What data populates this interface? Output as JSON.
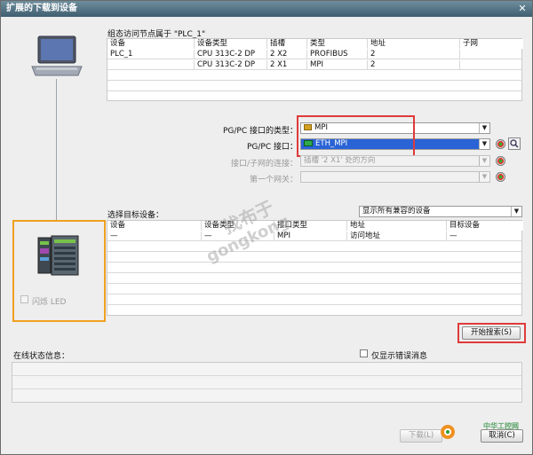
{
  "window": {
    "title": "扩展的下载到设备",
    "close_glyph": "✕"
  },
  "config_access": {
    "heading": "组态访问节点属于 \"PLC_1\"",
    "columns": [
      "设备",
      "设备类型",
      "插槽",
      "类型",
      "地址",
      "子网"
    ],
    "rows": [
      [
        "PLC_1",
        "CPU 313C-2 DP",
        "2 X2",
        "PROFIBUS",
        "2",
        ""
      ],
      [
        "",
        "CPU 313C-2 DP",
        "2 X1",
        "MPI",
        "2",
        ""
      ],
      [
        "",
        "",
        "",
        "",
        "",
        ""
      ],
      [
        "",
        "",
        "",
        "",
        "",
        ""
      ],
      [
        "",
        "",
        "",
        "",
        "",
        ""
      ]
    ]
  },
  "interface": {
    "type_label": "PG/PC 接口的类型：",
    "type_value": "MPI",
    "iface_label": "PG/PC 接口：",
    "iface_value": "ETH_MPI",
    "subnet_label": "接口/子网的连接：",
    "subnet_value": "插槽 '2 X1' 处的方向",
    "gateway_label": "第一个网关："
  },
  "target": {
    "heading": "选择目标设备：",
    "filter_value": "显示所有兼容的设备",
    "columns": [
      "设备",
      "设备类型",
      "接口类型",
      "地址",
      "目标设备"
    ],
    "rows": [
      [
        "—",
        "—",
        "MPI",
        "访问地址",
        "—"
      ],
      [
        "",
        "",
        "",
        "",
        ""
      ],
      [
        "",
        "",
        "",
        "",
        ""
      ],
      [
        "",
        "",
        "",
        "",
        ""
      ],
      [
        "",
        "",
        "",
        "",
        ""
      ],
      [
        "",
        "",
        "",
        "",
        ""
      ],
      [
        "",
        "",
        "",
        "",
        ""
      ],
      [
        "",
        "",
        "",
        "",
        ""
      ]
    ]
  },
  "flash_led_label": "闪烁 LED",
  "start_search_label": "开始搜索(S)",
  "online_status": {
    "heading": "在线状态信息：",
    "only_errors_label": "仅显示错误消息"
  },
  "download_label": "下载(L)",
  "cancel_label": "取消(C)",
  "watermark": {
    "line1": "找布于",
    "line2": "gongkong",
    "corner": "中华工控网"
  },
  "colors": {
    "red_highlight": "#e03a3a",
    "orange_highlight": "#f0a020",
    "selection_blue": "#2a63d6"
  }
}
